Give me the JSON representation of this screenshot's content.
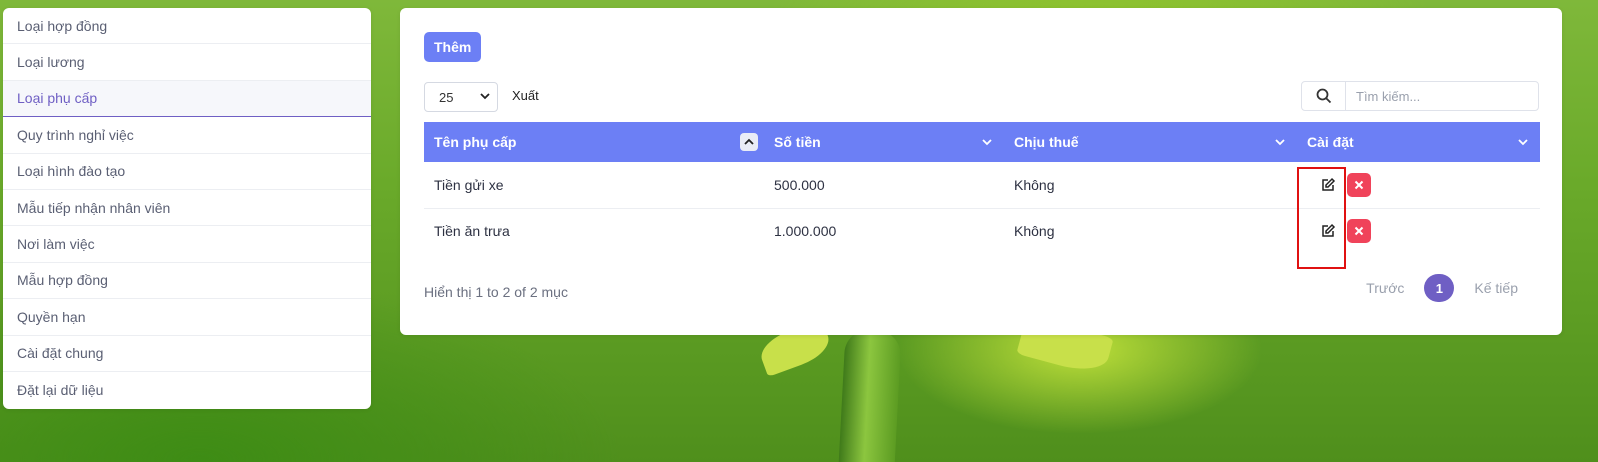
{
  "sidebar": {
    "items": [
      {
        "label": "Loại hợp đồng"
      },
      {
        "label": "Loại lương"
      },
      {
        "label": "Loại phụ cấp",
        "active": true
      },
      {
        "label": "Quy trình nghỉ việc"
      },
      {
        "label": "Loại hình đào tạo"
      },
      {
        "label": "Mẫu tiếp nhận nhân viên"
      },
      {
        "label": "Nơi làm việc"
      },
      {
        "label": "Mẫu hợp đồng"
      },
      {
        "label": "Quyền hạn"
      },
      {
        "label": "Cài đặt chung"
      },
      {
        "label": "Đặt lại dữ liệu"
      }
    ]
  },
  "toolbar": {
    "add_label": "Thêm",
    "page_size": "25",
    "export_label": "Xuất",
    "search_placeholder": "Tìm kiếm..."
  },
  "table": {
    "columns": [
      "Tên phụ cấp",
      "Số tiền",
      "Chịu thuế",
      "Cài đặt"
    ],
    "rows": [
      {
        "name": "Tiền gửi xe",
        "amount": "500.000",
        "taxable": "Không"
      },
      {
        "name": "Tiền ăn trưa",
        "amount": "1.000.000",
        "taxable": "Không"
      }
    ]
  },
  "footer": {
    "info": "Hiển thị 1 to 2 of 2 mục",
    "prev_label": "Trước",
    "current_page": "1",
    "next_label": "Kế tiếp"
  },
  "colors": {
    "accent": "#6c7ff5",
    "active_nav": "#6f5fc4",
    "delete": "#f0435a",
    "highlight_box": "#e01111"
  }
}
